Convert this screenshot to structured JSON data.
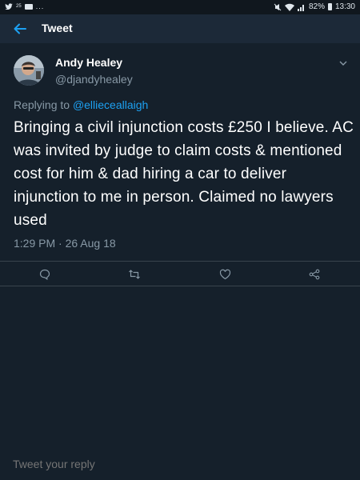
{
  "status_bar": {
    "notification_badge": "25",
    "overflow": "...",
    "battery_percent": "82%",
    "time": "13:30"
  },
  "header": {
    "title": "Tweet"
  },
  "tweet": {
    "author_name": "Andy Healey",
    "author_handle": "@djandyhealey",
    "replying_to_prefix": "Replying to",
    "replying_to_handle": "@ellieceallaigh",
    "text": "Bringing a civil injunction costs £250 I believe. AC was invited by judge to claim costs & mentioned cost for him & dad hiring a car to deliver injunction to me in person. Claimed no lawyers used",
    "timestamp": "1:29 PM · 26 Aug 18"
  },
  "actions": {
    "reply_icon": "speech-bubble-icon",
    "retweet_icon": "retweet-icon",
    "like_icon": "heart-icon",
    "share_icon": "share-icon"
  },
  "reply_bar": {
    "placeholder": "Tweet your reply"
  },
  "colors": {
    "background": "#15202b",
    "header": "#1c2938",
    "accent": "#1da1f2",
    "muted": "#8899a6",
    "divider": "#38444d"
  }
}
